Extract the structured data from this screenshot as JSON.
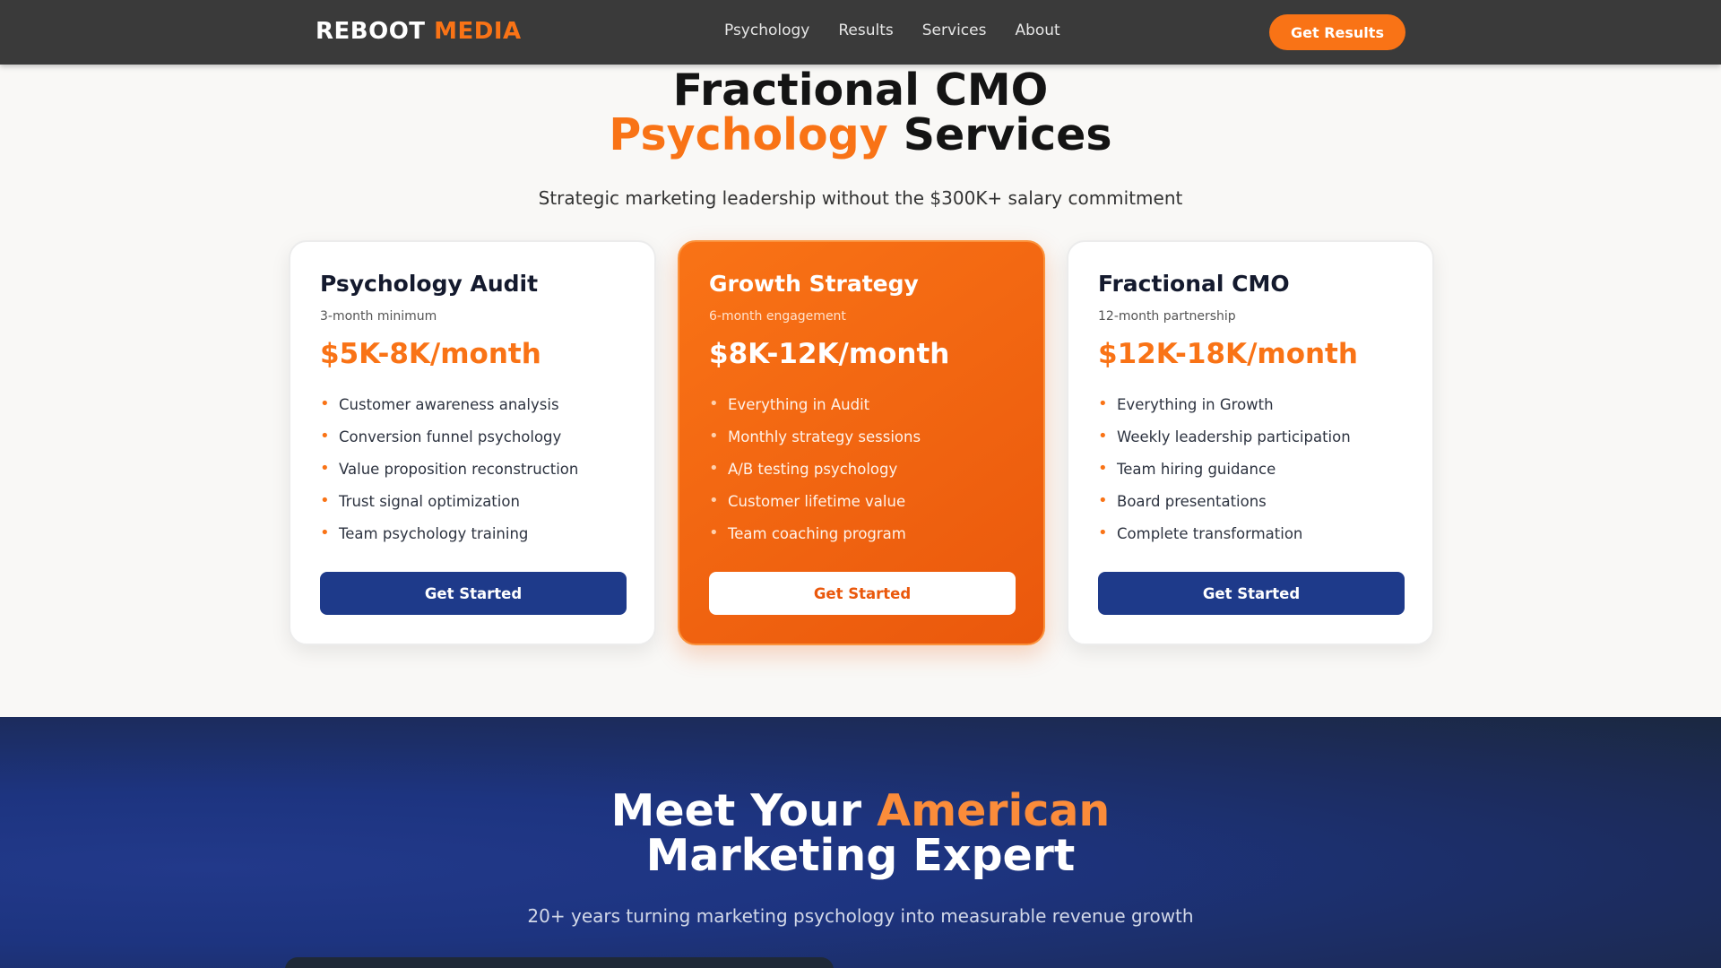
{
  "nav": {
    "brand_primary": "REBOOT",
    "brand_accent": "MEDIA",
    "links": [
      "Psychology",
      "Results",
      "Services",
      "About"
    ],
    "cta_label": "Get Results"
  },
  "services": {
    "title_line1": "Fractional CMO",
    "title_accent": "Psychology",
    "title_rest": "Services",
    "subtitle": "Strategic marketing leadership without the $300K+ salary commitment",
    "plans": [
      {
        "name": "Psychology Audit",
        "term": "3-month minimum",
        "price": "$5K-8K/month",
        "features": [
          "Customer awareness analysis",
          "Conversion funnel psychology",
          "Value proposition reconstruction",
          "Trust signal optimization",
          "Team psychology training"
        ],
        "button": "Get Started"
      },
      {
        "name": "Growth Strategy",
        "term": "6-month engagement",
        "price": "$8K-12K/month",
        "features": [
          "Everything in Audit",
          "Monthly strategy sessions",
          "A/B testing psychology",
          "Customer lifetime value",
          "Team coaching program"
        ],
        "button": "Get Started"
      },
      {
        "name": "Fractional CMO",
        "term": "12-month partnership",
        "price": "$12K-18K/month",
        "features": [
          "Everything in Growth",
          "Weekly leadership participation",
          "Team hiring guidance",
          "Board presentations",
          "Complete transformation"
        ],
        "button": "Get Started"
      }
    ]
  },
  "expert": {
    "title_prefix": "Meet Your",
    "title_accent": "American",
    "title_line2": "Marketing Expert",
    "subtitle": "20+ years turning marketing psychology into measurable revenue growth"
  },
  "colors": {
    "accent": "#f97316",
    "navy_button": "#1e3a8a",
    "nav_background": "#3a3a3a"
  }
}
